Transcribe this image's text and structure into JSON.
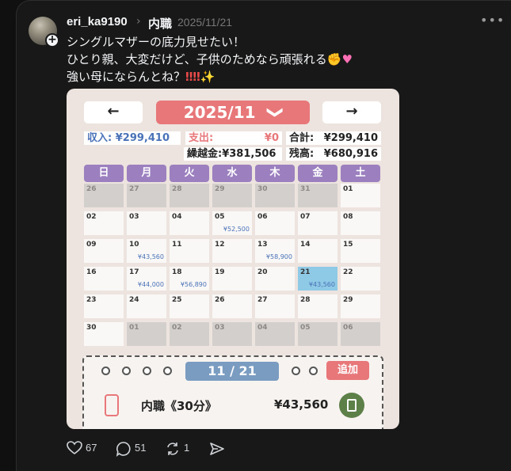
{
  "post": {
    "author": "eri_ka9190",
    "topic": "内職",
    "date": "2025/11/21",
    "lines": [
      "シングルマザーの底力見せたい！",
      "ひとり親、大変だけど、子供のためなら頑張れる",
      "強い母にならんとね？"
    ],
    "emoji_line2": [
      "muscle-emoji",
      "heart-emoji"
    ],
    "emoji_line3": [
      "double-exclamation-emoji",
      "double-exclamation-emoji",
      "sparkles-emoji"
    ]
  },
  "calendar": {
    "prev": "←",
    "next": "→",
    "month": "2025/11",
    "month_chevron": "❯",
    "income_label": "収入:",
    "income": "¥299,410",
    "expense_label": "支出:",
    "expense": "¥0",
    "total_label": "合計:",
    "total": "¥299,410",
    "carry_label": "繰越金:",
    "carry": "¥381,506",
    "balance_label": "残高:",
    "balance": "¥680,916",
    "weekdays": [
      "日",
      "月",
      "火",
      "水",
      "木",
      "金",
      "土"
    ],
    "weekday_colors": [
      "#9b7fbf",
      "#9b7fbf",
      "#9b7fbf",
      "#9b7fbf",
      "#9b7fbf",
      "#9b7fbf",
      "#9b7fbf"
    ],
    "weeks": [
      [
        {
          "d": "26",
          "out": true
        },
        {
          "d": "27",
          "out": true
        },
        {
          "d": "28",
          "out": true
        },
        {
          "d": "29",
          "out": true
        },
        {
          "d": "30",
          "out": true
        },
        {
          "d": "31",
          "out": true
        },
        {
          "d": "01"
        }
      ],
      [
        {
          "d": "02"
        },
        {
          "d": "03"
        },
        {
          "d": "04"
        },
        {
          "d": "05",
          "amt": "¥52,500"
        },
        {
          "d": "06"
        },
        {
          "d": "07"
        },
        {
          "d": "08"
        }
      ],
      [
        {
          "d": "09"
        },
        {
          "d": "10",
          "amt": "¥43,560"
        },
        {
          "d": "11"
        },
        {
          "d": "12"
        },
        {
          "d": "13",
          "amt": "¥58,900"
        },
        {
          "d": "14"
        },
        {
          "d": "15"
        }
      ],
      [
        {
          "d": "16"
        },
        {
          "d": "17",
          "amt": "¥44,000"
        },
        {
          "d": "18",
          "amt": "¥56,890"
        },
        {
          "d": "19"
        },
        {
          "d": "20"
        },
        {
          "d": "21",
          "amt": "¥43,560",
          "sel": true
        },
        {
          "d": "22"
        }
      ],
      [
        {
          "d": "23"
        },
        {
          "d": "24"
        },
        {
          "d": "25"
        },
        {
          "d": "26"
        },
        {
          "d": "27"
        },
        {
          "d": "28"
        },
        {
          "d": "29"
        }
      ],
      [
        {
          "d": "30"
        },
        {
          "d": "01",
          "out": true
        },
        {
          "d": "02",
          "out": true
        },
        {
          "d": "03",
          "out": true
        },
        {
          "d": "04",
          "out": true
        },
        {
          "d": "05",
          "out": true
        },
        {
          "d": "06",
          "out": true
        }
      ]
    ],
    "detail": {
      "date": "11 / 21",
      "add": "追加",
      "entry_name": "内職《30分》",
      "entry_amount": "¥43,560"
    }
  },
  "actions": {
    "likes": "67",
    "replies": "51",
    "reposts": "1"
  },
  "colors": {
    "accent_pink": "#e8777a",
    "accent_blue": "#7a9cc0",
    "weekday_purple": "#9b7fbf",
    "selected_cell": "#8ec9e6"
  }
}
